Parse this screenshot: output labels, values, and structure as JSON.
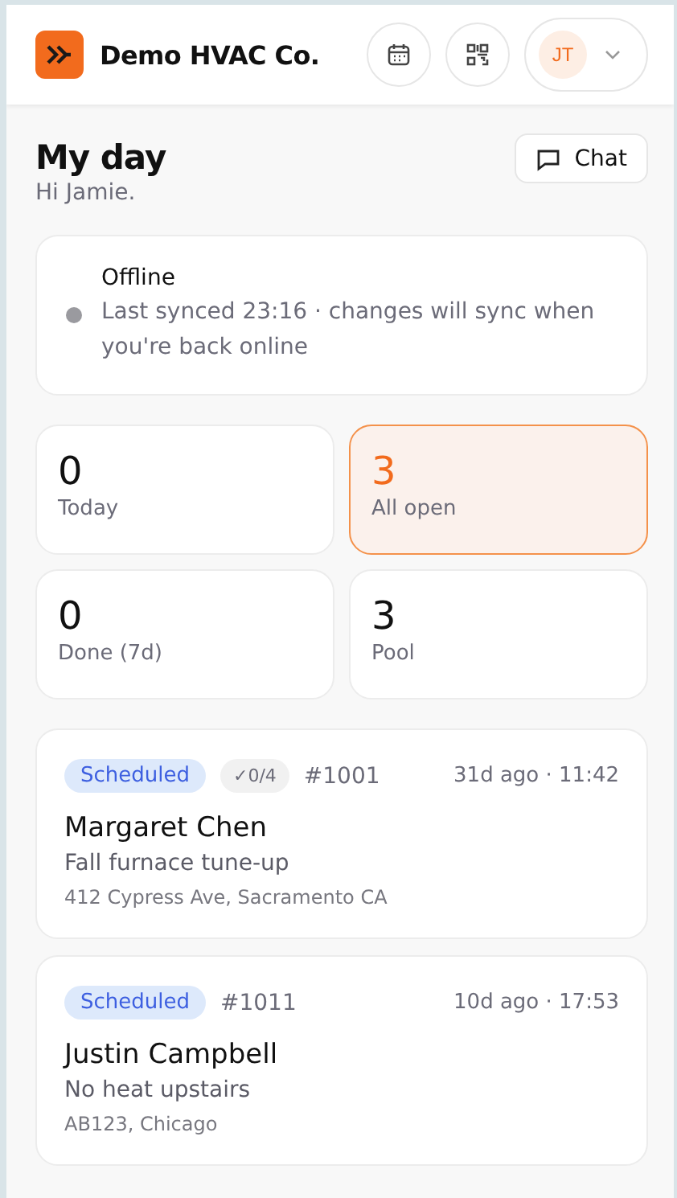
{
  "header": {
    "company": "Demo HVAC Co.",
    "avatar_initials": "JT"
  },
  "page": {
    "title": "My day",
    "greeting": "Hi Jamie.",
    "chat_button": "Chat"
  },
  "sync_status": {
    "online": false,
    "title": "Offline",
    "message": "Last synced 23:16 · changes will sync when you're back online"
  },
  "stats": [
    {
      "value": "0",
      "label": "Today",
      "selected": false
    },
    {
      "value": "3",
      "label": "All open",
      "selected": true
    },
    {
      "value": "0",
      "label": "Done (7d)",
      "selected": false
    },
    {
      "value": "3",
      "label": "Pool",
      "selected": false
    }
  ],
  "jobs": [
    {
      "status": "Scheduled",
      "checklist": "✓0/4",
      "number": "#1001",
      "time": "31d ago · 11:42",
      "customer": "Margaret Chen",
      "title": "Fall furnace tune-up",
      "address": "412 Cypress Ave, Sacramento CA"
    },
    {
      "status": "Scheduled",
      "number": "#1011",
      "time": "10d ago · 17:53",
      "customer": "Justin Campbell",
      "title": "No heat upstairs",
      "address": "AB123, Chicago"
    }
  ]
}
